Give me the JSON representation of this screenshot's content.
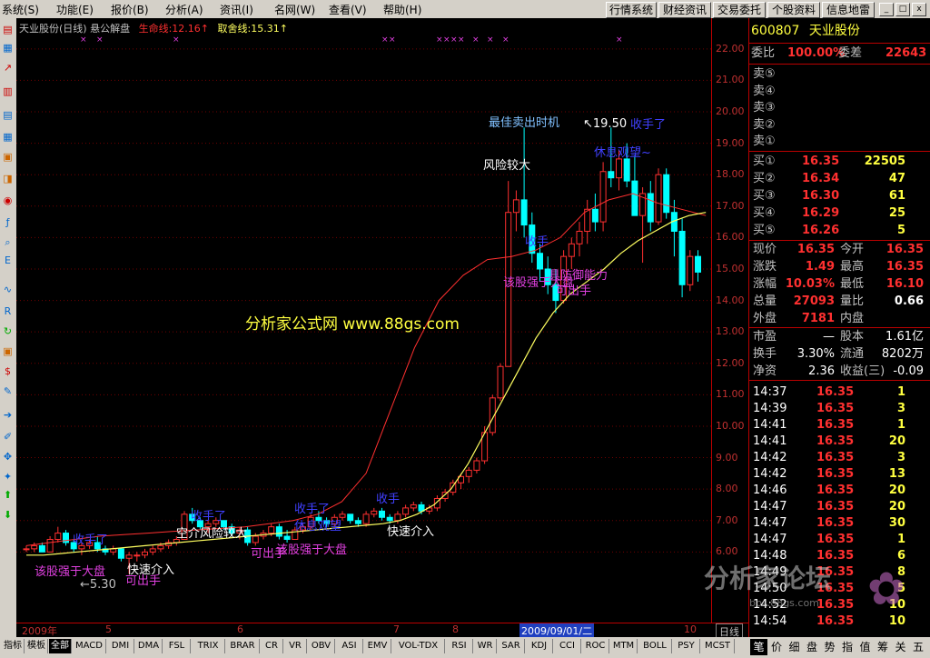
{
  "menu": [
    "系统(S)",
    "功能(E)",
    "报价(B)",
    "分析(A)",
    "资讯(I)",
    "名网(W)",
    "查看(V)",
    "帮助(H)"
  ],
  "top_buttons": [
    "行情系统",
    "财经资讯",
    "交易委托",
    "个股资料",
    "信息地雷"
  ],
  "window_buttons": [
    "_",
    "□",
    "x"
  ],
  "chart": {
    "stock_name": "天业股份(日线) 悬公解盘",
    "life_line_label": "生命线:12.16↑",
    "exit_line_label": "取舍线:15.31↑",
    "watermark": "分析家公式网 www.88gs.com",
    "watermark2": "分析家论坛",
    "watermark3": "bbs.88gs.com",
    "annotations": [
      {
        "text": "收手了",
        "color": "#4040ff"
      },
      {
        "text": "该股强于大盘",
        "color": "#e040e0"
      },
      {
        "text": "←5.30",
        "color": "#c0c0c0"
      },
      {
        "text": "快速介入",
        "color": "#ffffff"
      },
      {
        "text": "可出手",
        "color": "#e040e0"
      },
      {
        "text": "收手了",
        "color": "#4040ff"
      },
      {
        "text": "空介风险较大",
        "color": "#ffffff"
      },
      {
        "text": "可出手",
        "color": "#e040e0"
      },
      {
        "text": "该股强于大盘",
        "color": "#e040e0"
      },
      {
        "text": "收手了",
        "color": "#4040ff"
      },
      {
        "text": "休息观望",
        "color": "#4040ff"
      },
      {
        "text": "快速介入",
        "color": "#ffffff"
      },
      {
        "text": "收手",
        "color": "#4040ff"
      },
      {
        "text": "风险较大",
        "color": "#ffffff"
      },
      {
        "text": "最佳卖出时机",
        "color": "#80c0ff"
      },
      {
        "text": "↖19.50",
        "color": "#ffffff"
      },
      {
        "text": "收手了",
        "color": "#4040ff"
      },
      {
        "text": "休息观望~",
        "color": "#4040ff"
      },
      {
        "text": "收手",
        "color": "#4040ff"
      },
      {
        "text": "该股强于大盘",
        "color": "#e040e0"
      },
      {
        "text": "具防御能力",
        "color": "#e040e0"
      },
      {
        "text": "可出手",
        "color": "#e040e0"
      }
    ]
  },
  "chart_data": {
    "type": "candlestick",
    "title": "天业股份(日线)",
    "ylim": [
      5.2,
      22.4
    ],
    "y_ticks": [
      "22.00",
      "21.00",
      "20.00",
      "19.00",
      "18.00",
      "17.00",
      "16.00",
      "15.00",
      "14.00",
      "13.00",
      "12.00",
      "11.00",
      "10.00",
      "9.00",
      "8.00",
      "7.00",
      "6.00"
    ],
    "x_ticks": [
      "2009年",
      "5",
      "6",
      "7",
      "8",
      "2009/09/01/二",
      "10",
      "日线"
    ],
    "candles": [
      [
        6.1,
        6.2,
        6.0,
        6.1
      ],
      [
        6.1,
        6.3,
        6.0,
        6.2
      ],
      [
        6.2,
        6.3,
        6.0,
        6.0
      ],
      [
        6.0,
        6.5,
        6.0,
        6.4
      ],
      [
        6.4,
        6.8,
        6.3,
        6.6
      ],
      [
        6.6,
        6.7,
        6.2,
        6.3
      ],
      [
        6.3,
        6.4,
        6.0,
        6.1
      ],
      [
        6.1,
        6.3,
        5.9,
        6.2
      ],
      [
        6.2,
        6.4,
        6.1,
        6.3
      ],
      [
        6.3,
        6.5,
        6.0,
        6.1
      ],
      [
        6.1,
        6.2,
        5.9,
        6.0
      ],
      [
        6.0,
        6.2,
        5.9,
        6.1
      ],
      [
        6.1,
        6.1,
        5.7,
        5.8
      ],
      [
        5.8,
        6.0,
        5.3,
        5.9
      ],
      [
        5.9,
        6.0,
        5.7,
        5.9
      ],
      [
        5.9,
        6.1,
        5.8,
        6.0
      ],
      [
        6.0,
        6.2,
        5.9,
        6.1
      ],
      [
        6.1,
        6.3,
        6.0,
        6.2
      ],
      [
        6.2,
        6.4,
        6.1,
        6.3
      ],
      [
        6.3,
        6.5,
        6.2,
        6.4
      ],
      [
        6.4,
        7.3,
        6.4,
        7.2
      ],
      [
        7.2,
        7.4,
        6.9,
        7.0
      ],
      [
        7.0,
        7.1,
        6.7,
        6.8
      ],
      [
        6.8,
        7.0,
        6.6,
        6.9
      ],
      [
        6.9,
        7.1,
        6.8,
        7.0
      ],
      [
        7.0,
        7.0,
        6.7,
        6.8
      ],
      [
        6.8,
        6.9,
        6.5,
        6.6
      ],
      [
        6.6,
        6.8,
        6.4,
        6.7
      ],
      [
        6.7,
        6.8,
        6.2,
        6.3
      ],
      [
        6.3,
        6.6,
        6.2,
        6.5
      ],
      [
        6.5,
        6.7,
        6.4,
        6.6
      ],
      [
        6.6,
        6.9,
        6.5,
        6.8
      ],
      [
        6.8,
        6.9,
        6.4,
        6.5
      ],
      [
        6.5,
        6.7,
        6.3,
        6.4
      ],
      [
        6.4,
        6.8,
        6.4,
        6.7
      ],
      [
        6.7,
        6.9,
        6.6,
        6.8
      ],
      [
        6.8,
        7.2,
        6.7,
        7.1
      ],
      [
        7.1,
        7.3,
        6.9,
        7.0
      ],
      [
        7.0,
        7.1,
        6.8,
        6.9
      ],
      [
        6.9,
        7.2,
        6.8,
        7.1
      ],
      [
        7.1,
        7.3,
        7.0,
        7.2
      ],
      [
        7.2,
        7.2,
        6.9,
        7.0
      ],
      [
        7.0,
        7.1,
        6.8,
        6.9
      ],
      [
        6.9,
        7.3,
        6.8,
        7.2
      ],
      [
        7.2,
        7.4,
        7.1,
        7.3
      ],
      [
        7.3,
        7.4,
        7.0,
        7.1
      ],
      [
        7.1,
        7.2,
        6.9,
        7.0
      ],
      [
        7.0,
        7.3,
        6.9,
        7.2
      ],
      [
        7.2,
        7.5,
        7.1,
        7.4
      ],
      [
        7.4,
        7.6,
        7.3,
        7.5
      ],
      [
        7.5,
        7.6,
        7.2,
        7.3
      ],
      [
        7.3,
        7.5,
        7.2,
        7.4
      ],
      [
        7.4,
        7.8,
        7.3,
        7.7
      ],
      [
        7.7,
        8.0,
        7.6,
        7.9
      ],
      [
        7.9,
        8.3,
        7.8,
        8.2
      ],
      [
        8.2,
        8.5,
        8.0,
        8.4
      ],
      [
        8.4,
        8.7,
        8.2,
        8.6
      ],
      [
        8.6,
        9.0,
        8.5,
        8.9
      ],
      [
        8.9,
        10.0,
        8.8,
        9.8
      ],
      [
        9.8,
        11.0,
        9.7,
        10.9
      ],
      [
        10.9,
        12.0,
        10.8,
        11.9
      ],
      [
        11.9,
        17.8,
        11.9,
        16.8
      ],
      [
        16.8,
        17.5,
        16.2,
        17.2
      ],
      [
        17.2,
        19.5,
        16.0,
        16.4
      ],
      [
        16.4,
        16.8,
        15.2,
        15.5
      ],
      [
        15.5,
        15.8,
        14.6,
        15.0
      ],
      [
        15.0,
        15.4,
        14.2,
        14.5
      ],
      [
        14.5,
        15.0,
        13.6,
        14.0
      ],
      [
        14.0,
        15.6,
        13.9,
        15.4
      ],
      [
        15.4,
        16.0,
        15.0,
        15.8
      ],
      [
        15.8,
        16.5,
        15.4,
        16.2
      ],
      [
        16.2,
        17.2,
        15.8,
        16.9
      ],
      [
        16.9,
        17.4,
        16.2,
        16.5
      ],
      [
        16.5,
        18.4,
        16.2,
        18.1
      ],
      [
        18.1,
        19.5,
        17.6,
        17.9
      ],
      [
        17.9,
        18.8,
        17.5,
        18.5
      ],
      [
        18.5,
        19.0,
        17.6,
        17.8
      ],
      [
        17.8,
        18.6,
        16.8,
        16.7
      ],
      [
        16.7,
        17.6,
        15.2,
        17.4
      ],
      [
        17.4,
        17.8,
        16.2,
        16.5
      ],
      [
        16.5,
        18.2,
        16.4,
        18.0
      ],
      [
        18.0,
        18.2,
        16.6,
        16.8
      ],
      [
        16.8,
        17.2,
        15.4,
        16.2
      ],
      [
        16.2,
        16.6,
        14.1,
        14.5
      ],
      [
        14.5,
        15.6,
        14.3,
        15.4
      ],
      [
        15.4,
        15.6,
        14.6,
        14.9
      ]
    ],
    "ma_life": [
      5.9,
      5.9,
      5.95,
      6.0,
      6.05,
      6.1,
      6.15,
      6.2,
      6.25,
      6.3,
      6.35,
      6.4,
      6.45,
      6.5,
      6.55,
      6.6,
      6.65,
      6.7,
      6.75,
      6.8,
      6.85,
      6.9,
      7.0,
      7.2,
      7.5,
      8.0,
      8.8,
      9.8,
      10.8,
      11.8,
      12.8,
      13.6,
      14.2,
      14.6,
      15.0,
      15.5,
      15.9,
      16.2,
      16.5,
      16.7,
      16.8
    ],
    "ma_exit": [
      6.2,
      6.3,
      6.4,
      6.5,
      6.55,
      6.6,
      6.65,
      6.7,
      6.75,
      6.8,
      6.9,
      7.0,
      7.2,
      7.6,
      8.5,
      10.5,
      12.5,
      14.0,
      14.8,
      15.3,
      15.4,
      15.6,
      16.0,
      16.8,
      17.2,
      17.4,
      17.1,
      16.9,
      16.7
    ]
  },
  "quote": {
    "code": "600807",
    "name": "天业股份",
    "weibi_label": "委比",
    "weibi_value": "100.00%",
    "weicha_label": "委差",
    "weicha_value": "22643",
    "sells": [
      {
        "label": "卖⑤",
        "price": "",
        "vol": ""
      },
      {
        "label": "卖④",
        "price": "",
        "vol": ""
      },
      {
        "label": "卖③",
        "price": "",
        "vol": ""
      },
      {
        "label": "卖②",
        "price": "",
        "vol": ""
      },
      {
        "label": "卖①",
        "price": "",
        "vol": ""
      }
    ],
    "buys": [
      {
        "label": "买①",
        "price": "16.35",
        "vol": "22505"
      },
      {
        "label": "买②",
        "price": "16.34",
        "vol": "47"
      },
      {
        "label": "买③",
        "price": "16.30",
        "vol": "61"
      },
      {
        "label": "买④",
        "price": "16.29",
        "vol": "25"
      },
      {
        "label": "买⑤",
        "price": "16.26",
        "vol": "5"
      }
    ],
    "stats": [
      {
        "l1": "现价",
        "v1": "16.35",
        "l2": "今开",
        "v2": "16.35"
      },
      {
        "l1": "涨跌",
        "v1": "1.49",
        "l2": "最高",
        "v2": "16.35"
      },
      {
        "l1": "涨幅",
        "v1": "10.03%",
        "l2": "最低",
        "v2": "16.10"
      },
      {
        "l1": "总量",
        "v1": "27093",
        "l2": "量比",
        "v2": "0.66"
      },
      {
        "l1": "外盘",
        "v1": "7181",
        "l2": "内盘",
        "v2": ""
      }
    ],
    "stats2": [
      {
        "l1": "市盈",
        "v1": "—",
        "l2": "股本",
        "v2": "1.61亿"
      },
      {
        "l1": "换手",
        "v1": "3.30%",
        "l2": "流通",
        "v2": "8202万"
      },
      {
        "l1": "净资",
        "v1": "2.36",
        "l2": "收益(三)",
        "v2": "-0.09"
      }
    ],
    "ticks": [
      {
        "time": "14:37",
        "price": "16.35",
        "vol": "1"
      },
      {
        "time": "14:39",
        "price": "16.35",
        "vol": "3"
      },
      {
        "time": "14:41",
        "price": "16.35",
        "vol": "1"
      },
      {
        "time": "14:41",
        "price": "16.35",
        "vol": "20"
      },
      {
        "time": "14:42",
        "price": "16.35",
        "vol": "3"
      },
      {
        "time": "14:42",
        "price": "16.35",
        "vol": "13"
      },
      {
        "time": "14:46",
        "price": "16.35",
        "vol": "20"
      },
      {
        "time": "14:47",
        "price": "16.35",
        "vol": "20"
      },
      {
        "time": "14:47",
        "price": "16.35",
        "vol": "30"
      },
      {
        "time": "14:47",
        "price": "16.35",
        "vol": "1"
      },
      {
        "time": "14:48",
        "price": "16.35",
        "vol": "6"
      },
      {
        "time": "14:49",
        "price": "16.35",
        "vol": "8"
      },
      {
        "time": "14:50",
        "price": "16.35",
        "vol": "5"
      },
      {
        "time": "14:52",
        "price": "16.35",
        "vol": "10"
      },
      {
        "time": "14:54",
        "price": "16.35",
        "vol": "10"
      }
    ]
  },
  "date_axis": [
    "2009年",
    "5",
    "6",
    "7",
    "8",
    "2009/09/01/二",
    "10",
    "日线"
  ],
  "bottom_tabs": [
    "指标",
    "模板",
    "全部",
    "MACD",
    "DMI",
    "DMA",
    "FSL",
    "TRIX",
    "BRAR",
    "CR",
    "VR",
    "OBV",
    "ASI",
    "EMV",
    "VOL-TDX",
    "RSI",
    "WR",
    "SAR",
    "KDJ",
    "CCI",
    "ROC",
    "MTM",
    "BOLL",
    "PSY",
    "MCST"
  ],
  "right_tabs": [
    "笔",
    "价",
    "细",
    "盘",
    "势",
    "指",
    "值",
    "筹",
    "关",
    "五"
  ],
  "colors": {
    "up": "#ff3030",
    "down": "#00ffff",
    "life": "#ffff60",
    "exit": "#ff3030",
    "axis": "#c03030"
  }
}
